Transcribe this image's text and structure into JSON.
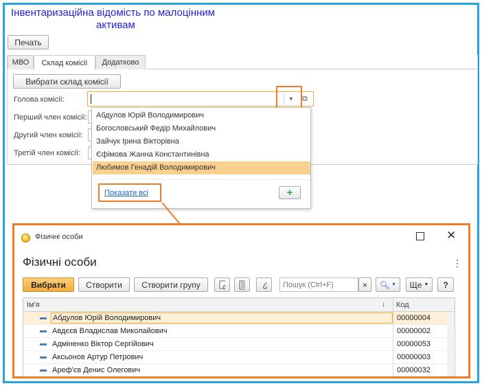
{
  "page": {
    "title_line1": "Інвентаризаційна відомість по малоцінним",
    "title_line2": "активам",
    "print_button": "Печать",
    "tabs": [
      "МВО",
      "Склад комісії",
      "Додатково"
    ],
    "select_commission_button": "Вибрати склад комісії"
  },
  "form": {
    "labels": {
      "chairman": "Голова комісії:",
      "member1": "Перший член комісії:",
      "member2": "Другий член комісії:",
      "member3": "Третій член комісії:"
    }
  },
  "dropdown": {
    "items": [
      "Абдулов Юрій Володимирович",
      "Богословський Федір Михайлович",
      "Зайчук Ірина Вікторівна",
      "Єфімова Жанна Константинівна",
      "Любимов Генадій Володимирович"
    ],
    "selected_index": 4,
    "show_all": "Показати всі",
    "add_button": "+"
  },
  "dialog": {
    "window_title": "Фізичні особи",
    "heading": "Фізичні особи",
    "toolbar": {
      "select": "Вибрати",
      "create": "Створити",
      "create_group": "Створити групу",
      "search_placeholder": "Пошук (Ctrl+F)",
      "clear": "×",
      "more": "Ще",
      "help": "?"
    },
    "table": {
      "columns": [
        "Ім'я",
        "Код"
      ],
      "sort_indicator": "↓",
      "rows": [
        {
          "name": "Абдулов Юрій Володимирович",
          "code": "00000004"
        },
        {
          "name": "Авдєєв Владислав Миколайович",
          "code": "00000002"
        },
        {
          "name": "Адміненко Віктор Сергійович",
          "code": "00000053"
        },
        {
          "name": "Аксьонов Артур Петрович",
          "code": "00000003"
        },
        {
          "name": "Ареф'єв Денис Олегович",
          "code": "00000032"
        }
      ]
    }
  },
  "colors": {
    "frame": "#27a3dd",
    "title": "#1f1fe0",
    "highlight": "#f07c27",
    "selected_row": "#fbd18f",
    "primary_button": "#f1aa3b",
    "link": "#1a66c4",
    "plus": "#2aa33a"
  }
}
